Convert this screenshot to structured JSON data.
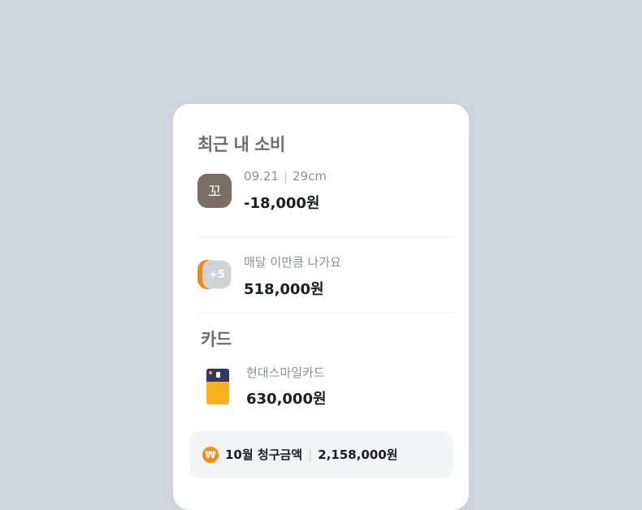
{
  "recent_spending": {
    "title": "최근 내 소비",
    "latest": {
      "date": "09.21",
      "merchant": "29cm",
      "amount": "-18,000원",
      "icon": "merchant-logo-icon",
      "icon_glyph": "꼬"
    },
    "monthly": {
      "label": "매달 이만큼 나가요",
      "amount": "518,000원",
      "badge": "+5"
    }
  },
  "cards": {
    "title": "카드",
    "items": [
      {
        "name": "현대스마일카드",
        "amount": "630,000원"
      }
    ]
  },
  "bill": {
    "label": "10월 청구금액",
    "amount": "2,158,000원",
    "icon_glyph": "₩"
  },
  "colors": {
    "background": "#cfd6de",
    "accent_orange": "#f58f12",
    "card_navy": "#2f3868",
    "card_yellow": "#f9b21a",
    "merchant_brown": "#7b6e62"
  }
}
